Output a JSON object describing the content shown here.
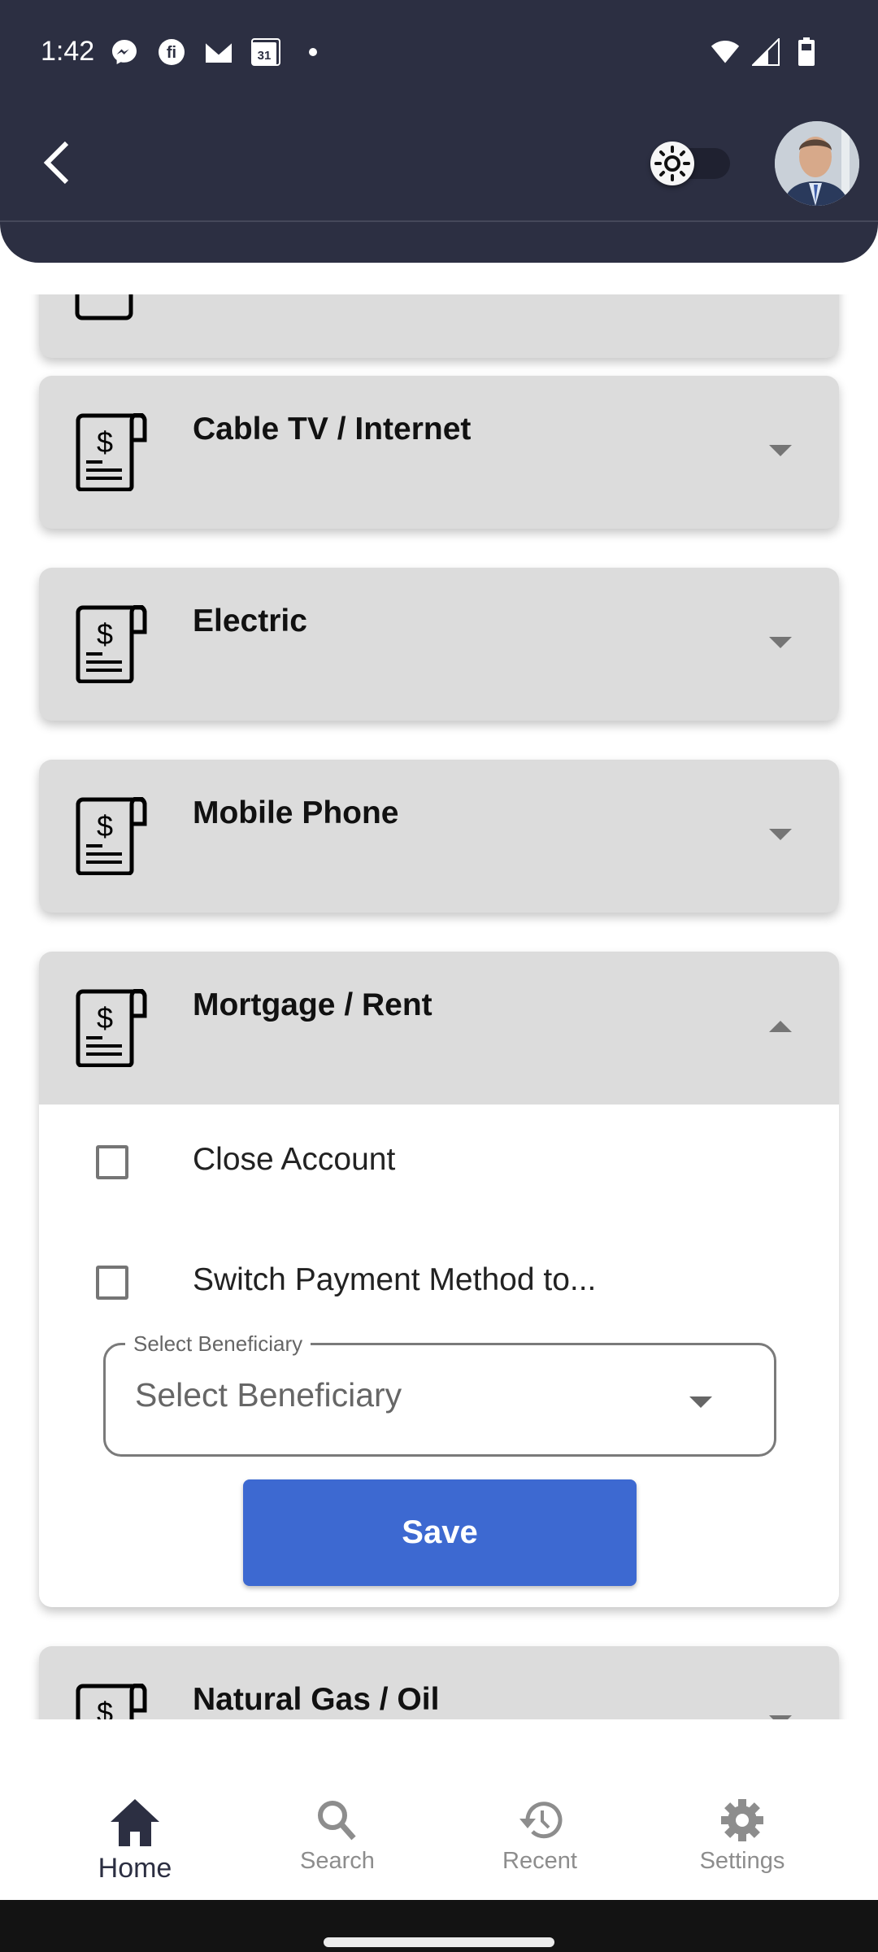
{
  "status_bar": {
    "time": "1:42",
    "left_icons": [
      "messenger-icon",
      "fi-app-icon",
      "gmail-icon",
      "calendar-icon",
      "notification-dot-icon"
    ],
    "calendar_day": "31",
    "right_icons": [
      "wifi-icon",
      "signal-icon",
      "battery-icon"
    ]
  },
  "header": {
    "back_icon": "chevron-left-icon",
    "theme_toggle": {
      "icon": "sun-icon",
      "state": "light"
    },
    "avatar_alt": "User profile photo"
  },
  "bill_categories": [
    {
      "title": "",
      "expanded": false,
      "partial": true
    },
    {
      "title": "Cable TV / Internet",
      "expanded": false
    },
    {
      "title": "Electric",
      "expanded": false
    },
    {
      "title": "Mobile Phone",
      "expanded": false
    },
    {
      "title": "Mortgage / Rent",
      "expanded": true,
      "options": [
        {
          "label": "Close Account",
          "checked": false
        },
        {
          "label": "Switch Payment Method to...",
          "checked": false
        }
      ],
      "beneficiary_select": {
        "label": "Select Beneficiary",
        "value": "Select Beneficiary"
      },
      "save_label": "Save"
    },
    {
      "title": "Natural Gas / Oil",
      "expanded": false,
      "partial": true
    }
  ],
  "bottom_nav": {
    "items": [
      {
        "label": "Home",
        "icon": "home-icon",
        "active": true
      },
      {
        "label": "Search",
        "icon": "search-icon",
        "active": false
      },
      {
        "label": "Recent",
        "icon": "history-icon",
        "active": false
      },
      {
        "label": "Settings",
        "icon": "gear-icon",
        "active": false
      }
    ]
  },
  "colors": {
    "header_bg": "#2c2f42",
    "card_bg": "#dcdcdc",
    "primary_button": "#3d69d1",
    "nav_active": "#2c2f42",
    "nav_inactive": "#8d8d8d"
  }
}
